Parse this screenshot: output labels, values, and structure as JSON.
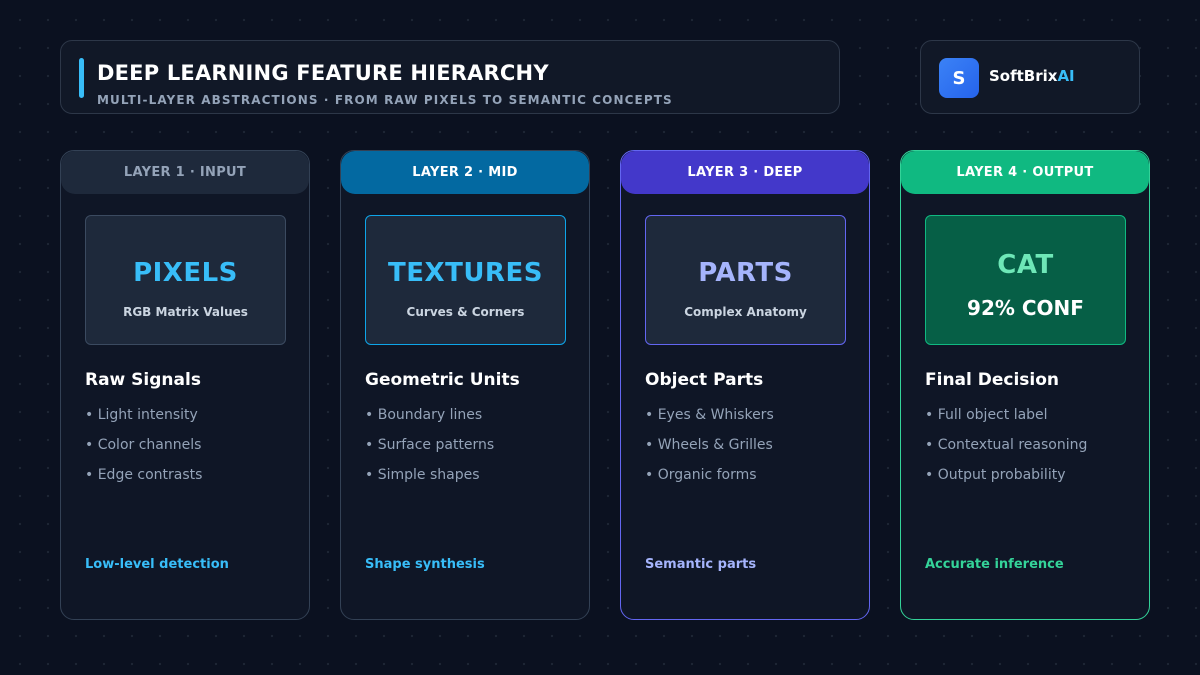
{
  "header": {
    "title": "DEEP LEARNING FEATURE HIERARCHY",
    "subtitle": "MULTI-LAYER ABSTRACTIONS · FROM RAW PIXELS TO SEMANTIC CONCEPTS"
  },
  "brand": {
    "icon_letter": "S",
    "name_main": "SoftBrix",
    "name_accent": "AI"
  },
  "layers": [
    {
      "label": "LAYER 1 · INPUT",
      "feature": "PIXELS",
      "feature_sub": "RGB Matrix Values",
      "section_title": "Raw Signals",
      "bullets": [
        "• Light intensity",
        "• Color channels",
        "• Edge contrasts"
      ],
      "footer": "Low-level detection",
      "accent_color": "#38bdf8"
    },
    {
      "label": "LAYER 2 · MID",
      "feature": "TEXTURES",
      "feature_sub": "Curves & Corners",
      "section_title": "Geometric Units",
      "bullets": [
        "• Boundary lines",
        "• Surface patterns",
        "• Simple shapes"
      ],
      "footer": "Shape synthesis",
      "accent_color": "#0ea5e9"
    },
    {
      "label": "LAYER 3 · DEEP",
      "feature": "PARTS",
      "feature_sub": "Complex Anatomy",
      "section_title": "Object Parts",
      "bullets": [
        "• Eyes & Whiskers",
        "• Wheels & Grilles",
        "• Organic forms"
      ],
      "footer": "Semantic parts",
      "accent_color": "#6366f1"
    },
    {
      "label": "LAYER 4 · OUTPUT",
      "feature": "CAT",
      "feature_sub": "92% CONF",
      "section_title": "Final Decision",
      "bullets": [
        "• Full object label",
        "• Contextual reasoning",
        "• Output probability"
      ],
      "footer": "Accurate inference",
      "accent_color": "#10b981"
    }
  ]
}
